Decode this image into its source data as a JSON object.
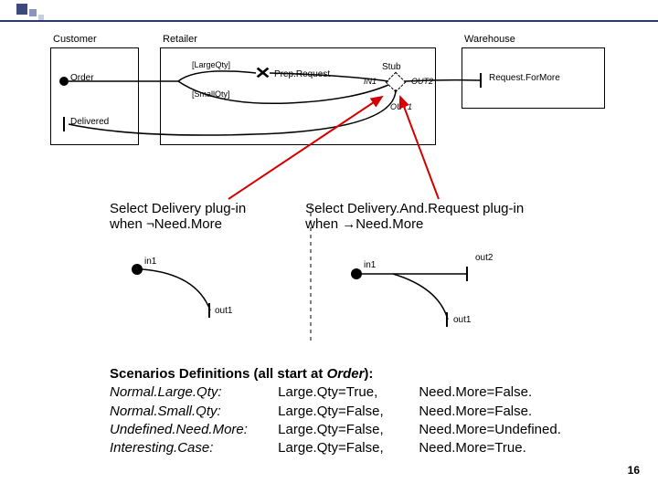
{
  "lanes": {
    "customer": "Customer",
    "retailer": "Retailer",
    "warehouse": "Warehouse"
  },
  "nodes": {
    "order": "Order",
    "delivered": "Delivered",
    "prep": "Prep.Request",
    "large_guard": "[LargeQty]",
    "small_guard": "[SmallQty]",
    "stub": "Stub",
    "in1": "IN1",
    "out1": "OUT1",
    "out2": "OUT2",
    "request_more": "Request.ForMore"
  },
  "plugins": {
    "left_line1": "Select Delivery plug-in",
    "left_line2": "when ¬Need.More",
    "right_line1": "Select Delivery.And.Request plug-in",
    "right_line2": "when →Need.More"
  },
  "sub": {
    "in1_l": "in1",
    "out1_l": "out1",
    "in1_r": "in1",
    "out1_r": "out1",
    "out2_r": "out2"
  },
  "scenarios": {
    "heading_a": "Scenarios Definitions (all start at ",
    "heading_b": "Order",
    "heading_c": "):",
    "rows": [
      {
        "name": "Normal.Large.Qty:",
        "col2": "Large.Qty=True,",
        "col3": "Need.More=False."
      },
      {
        "name": "Normal.Small.Qty:",
        "col2": "Large.Qty=False,",
        "col3": "Need.More=False."
      },
      {
        "name": "Undefined.Need.More:",
        "col2": "Large.Qty=False,",
        "col3": "Need.More=Undefined."
      },
      {
        "name": "Interesting.Case:",
        "col2": "Large.Qty=False,",
        "col3": "Need.More=True."
      }
    ]
  },
  "page": "16"
}
